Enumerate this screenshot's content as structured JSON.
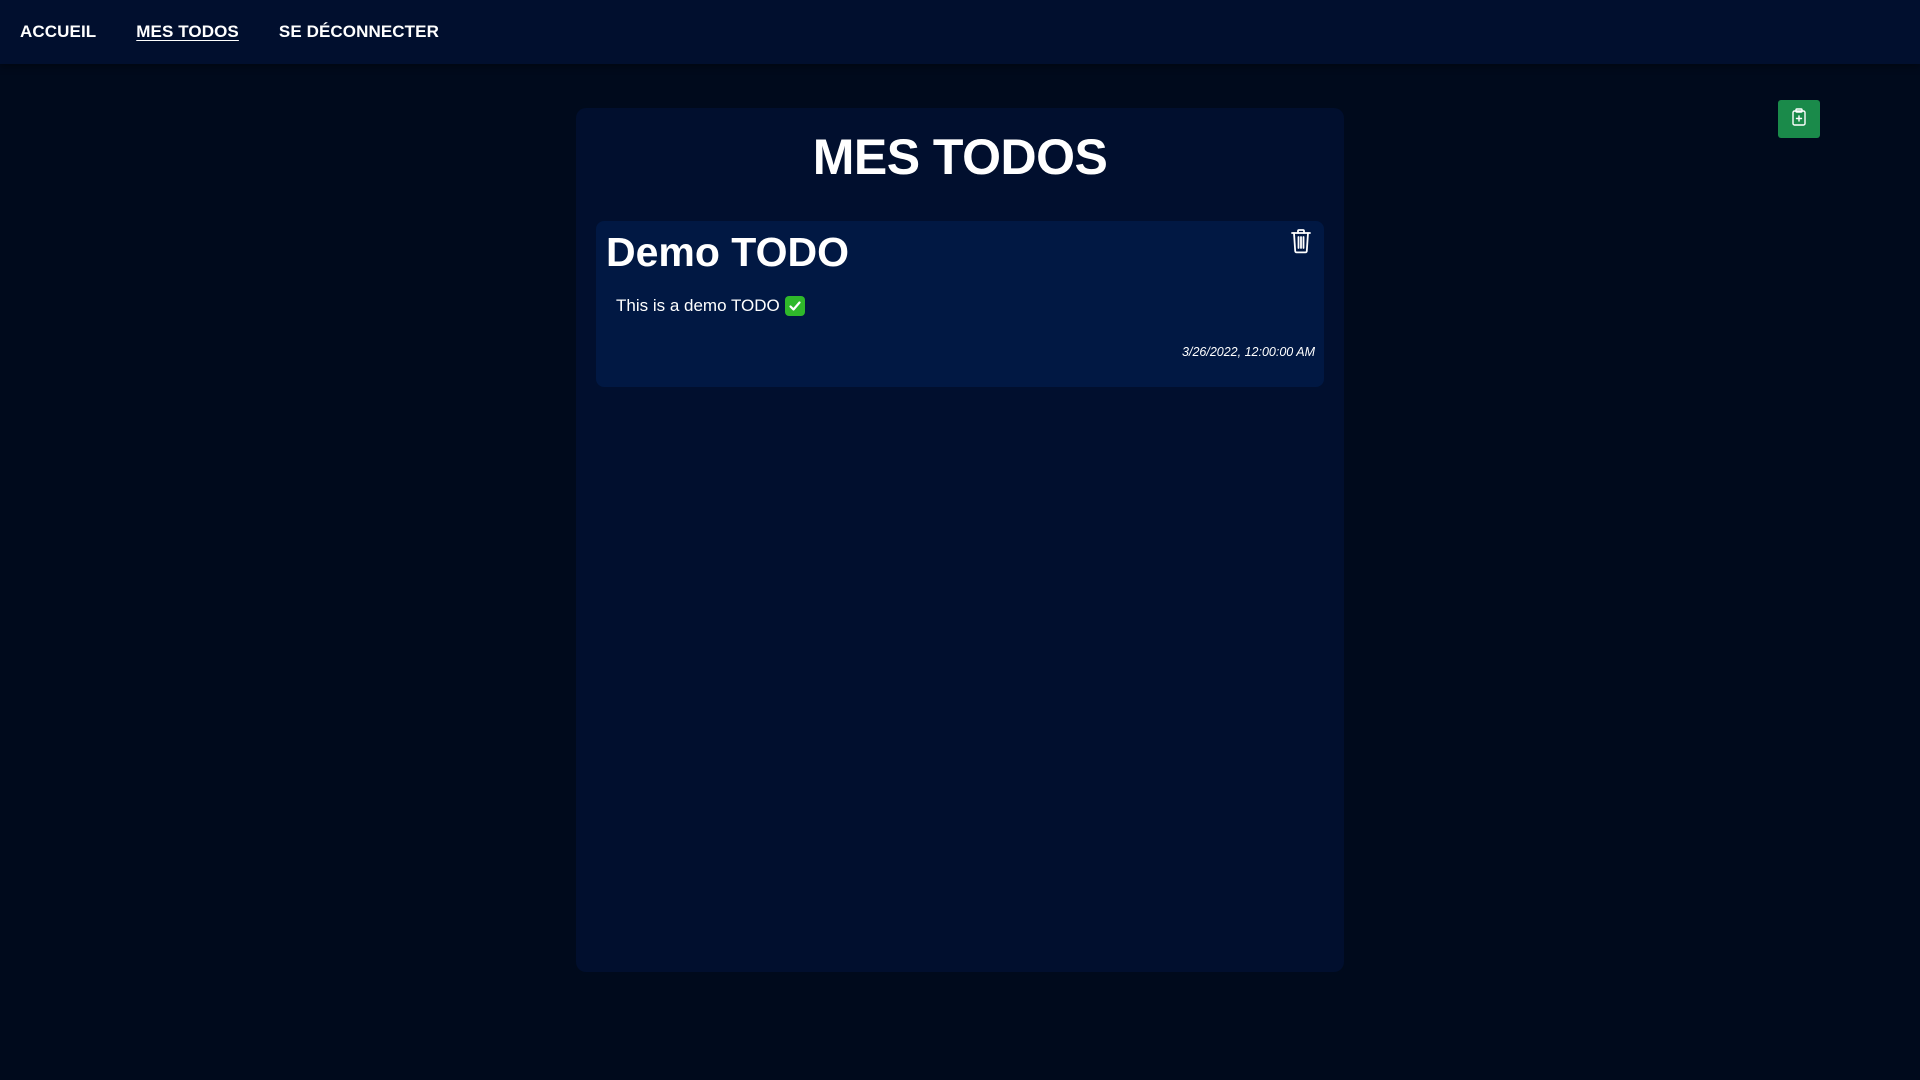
{
  "nav": {
    "items": [
      {
        "label": "ACCUEIL",
        "active": false
      },
      {
        "label": "MES TODOS",
        "active": true
      },
      {
        "label": "SE DÉCONNECTER",
        "active": false
      }
    ]
  },
  "actions": {
    "add_icon": "clipboard-plus-icon",
    "add_color": "#1a8a4a"
  },
  "main": {
    "title": "MES TODOS",
    "todos": [
      {
        "title": "Demo TODO",
        "description": "This is a demo TODO",
        "status_emoji": "check-mark-button-icon",
        "date": "3/26/2022, 12:00:00 AM",
        "delete_icon": "trash-icon"
      }
    ]
  },
  "colors": {
    "page_background": "#000a1c",
    "nav_background": "#010f2e",
    "panel_background": "#010f2e",
    "card_background": "#011843"
  }
}
